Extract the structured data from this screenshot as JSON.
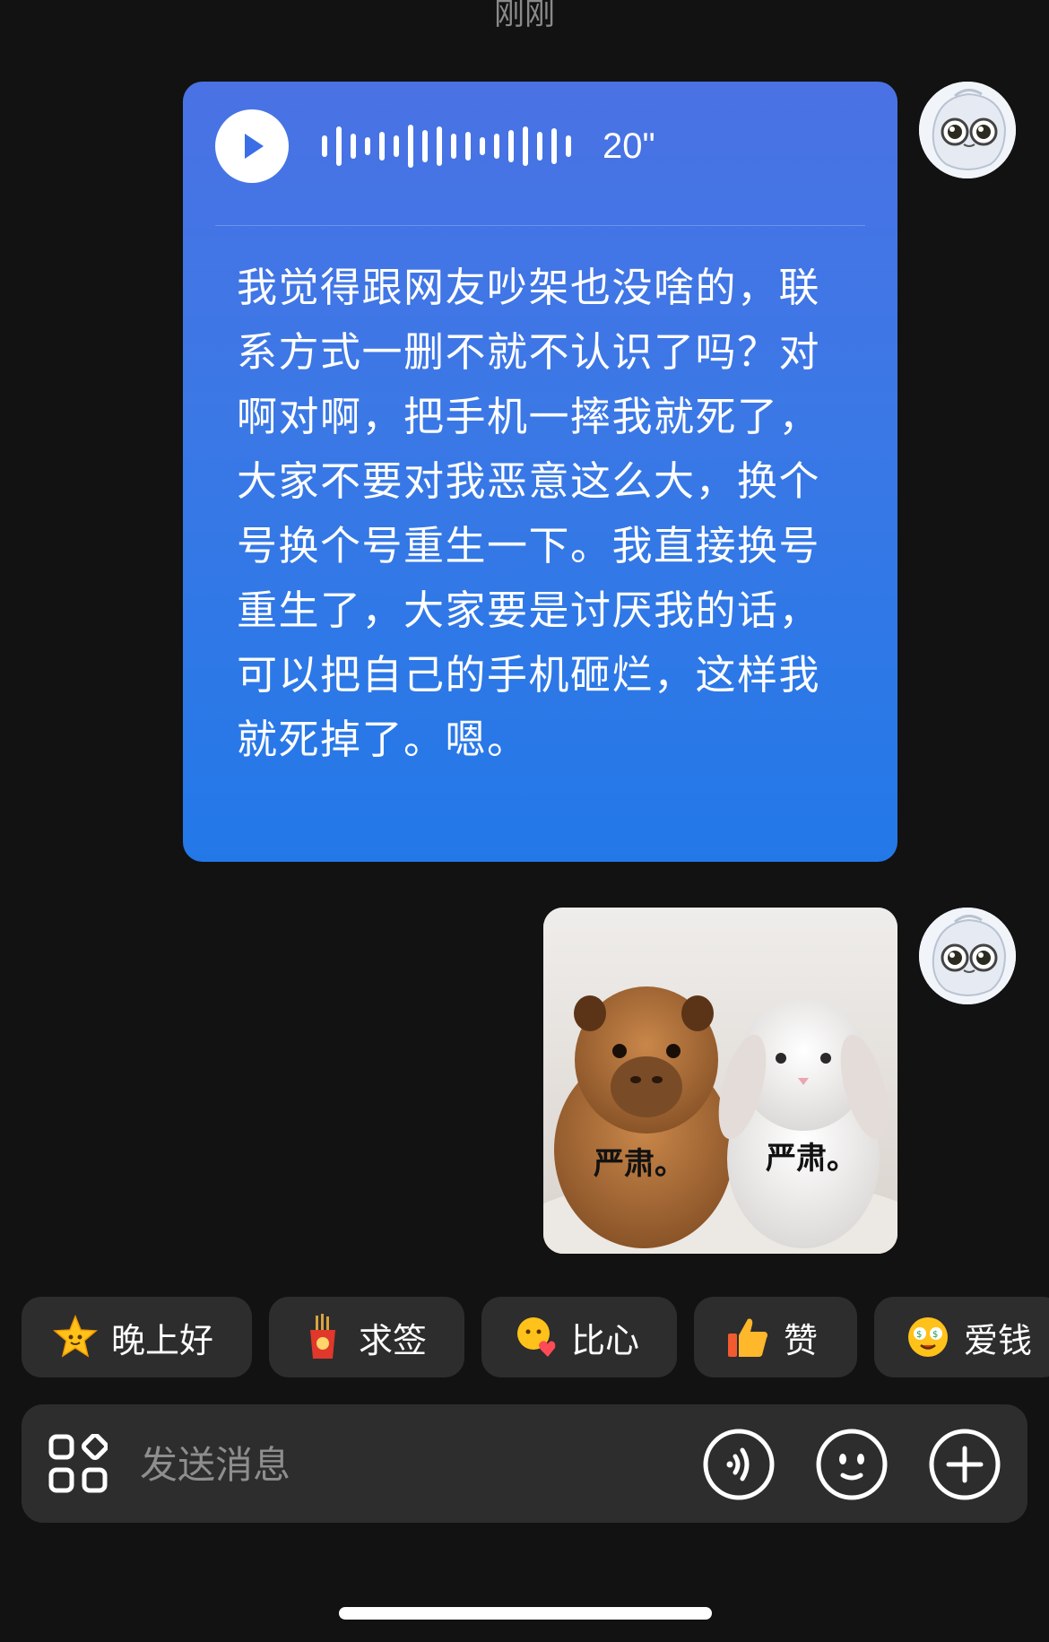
{
  "chat": {
    "timestamp": "刚刚"
  },
  "voice_message": {
    "duration": "20\"",
    "transcript": "我觉得跟网友吵架也没啥的，联系方式一删不就不认识了吗？对啊对啊，把手机一摔我就死了，大家不要对我恶意这么大，换个号换个号重生一下。我直接换号重生了，大家要是讨厌我的话，可以把自己的手机砸烂，这样我就死掉了。嗯。"
  },
  "image_message": {
    "caption_left": "严肃。",
    "caption_right": "严肃。"
  },
  "quick_replies": [
    {
      "label": "晚上好",
      "icon": "star-face-icon"
    },
    {
      "label": "求签",
      "icon": "fortune-sticks-icon"
    },
    {
      "label": "比心",
      "icon": "heart-hands-icon"
    },
    {
      "label": "赞",
      "icon": "thumbs-up-icon"
    },
    {
      "label": "爱钱",
      "icon": "money-eyes-icon"
    }
  ],
  "composer": {
    "placeholder": "发送消息",
    "icons": [
      "apps-grid-icon",
      "voice-input-icon",
      "emoji-icon",
      "plus-icon"
    ]
  },
  "colors": {
    "background": "#121212",
    "bubble_top": "#4a72e4",
    "bubble_bottom": "#2378e8",
    "chip": "#2d2d2d"
  }
}
